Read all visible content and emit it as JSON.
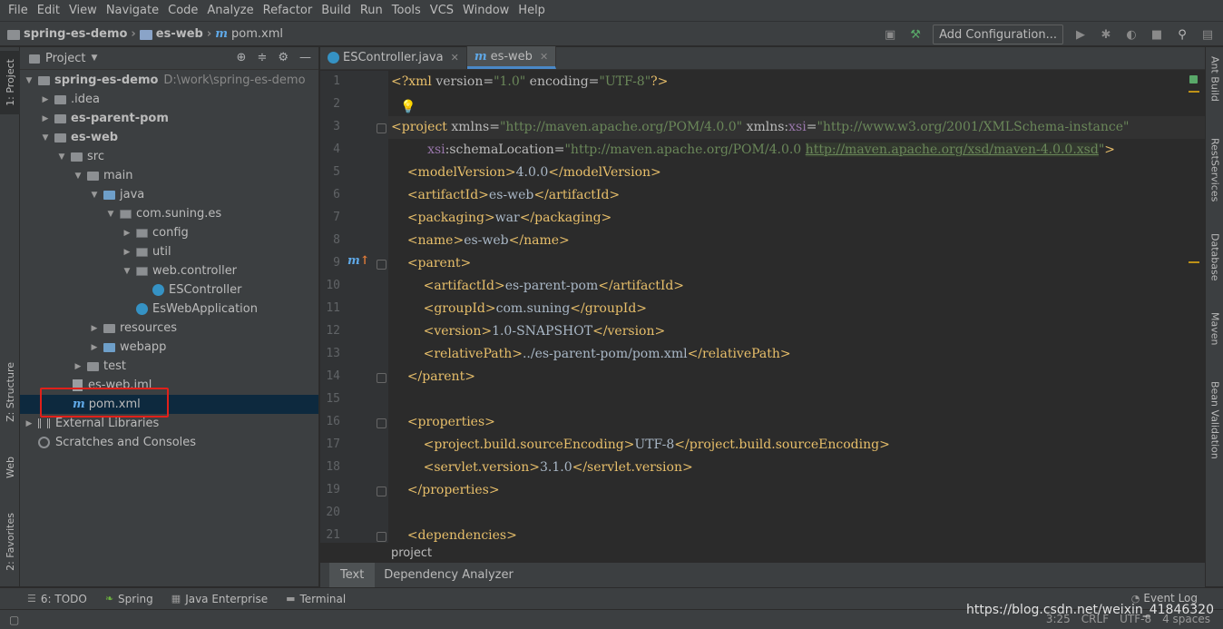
{
  "menu": [
    "File",
    "Edit",
    "View",
    "Navigate",
    "Code",
    "Analyze",
    "Refactor",
    "Build",
    "Run",
    "Tools",
    "VCS",
    "Window",
    "Help"
  ],
  "nav": {
    "crumbs": [
      "spring-es-demo",
      "es-web",
      "pom.xml"
    ],
    "add_config": "Add Configuration..."
  },
  "left_stripe": {
    "project": "1: Project",
    "structure": "Z: Structure",
    "web": "Web",
    "favorites": "2: Favorites"
  },
  "right_stripe": {
    "ant": "Ant Build",
    "rest": "RestServices",
    "database": "Database",
    "maven": "Maven",
    "bean": "Bean Validation"
  },
  "project_panel": {
    "title": "Project",
    "tree": [
      {
        "label": "spring-es-demo",
        "extra": "D:\\work\\spring-es-demo"
      },
      {
        "label": ".idea"
      },
      {
        "label": "es-parent-pom"
      },
      {
        "label": "es-web"
      },
      {
        "label": "src"
      },
      {
        "label": "main"
      },
      {
        "label": "java"
      },
      {
        "label": "com.suning.es"
      },
      {
        "label": "config"
      },
      {
        "label": "util"
      },
      {
        "label": "web.controller"
      },
      {
        "label": "ESController"
      },
      {
        "label": "EsWebApplication"
      },
      {
        "label": "resources"
      },
      {
        "label": "webapp"
      },
      {
        "label": "test"
      },
      {
        "label": "es-web.iml"
      },
      {
        "label": "pom.xml"
      },
      {
        "label": "External Libraries"
      },
      {
        "label": "Scratches and Consoles"
      }
    ]
  },
  "editor": {
    "tabs": [
      "ESController.java",
      "es-web"
    ],
    "line_numbers": [
      "1",
      "2",
      "3",
      "4",
      "5",
      "6",
      "7",
      "8",
      "9",
      "10",
      "11",
      "12",
      "13",
      "14",
      "15",
      "16",
      "17",
      "18",
      "19",
      "20",
      "21"
    ],
    "breadcrumb": "project",
    "bottom_tabs": [
      "Text",
      "Dependency Analyzer"
    ]
  },
  "toolwindows": {
    "todo": "6: TODO",
    "spring": "Spring",
    "java_ee": "Java Enterprise",
    "terminal": "Terminal",
    "event_log": "Event Log"
  },
  "status": {
    "position": "3:25",
    "line_sep": "CRLF",
    "encoding": "UTF-8",
    "indent": "4 spaces"
  },
  "watermark": "https://blog.csdn.net/weixin_41846320"
}
